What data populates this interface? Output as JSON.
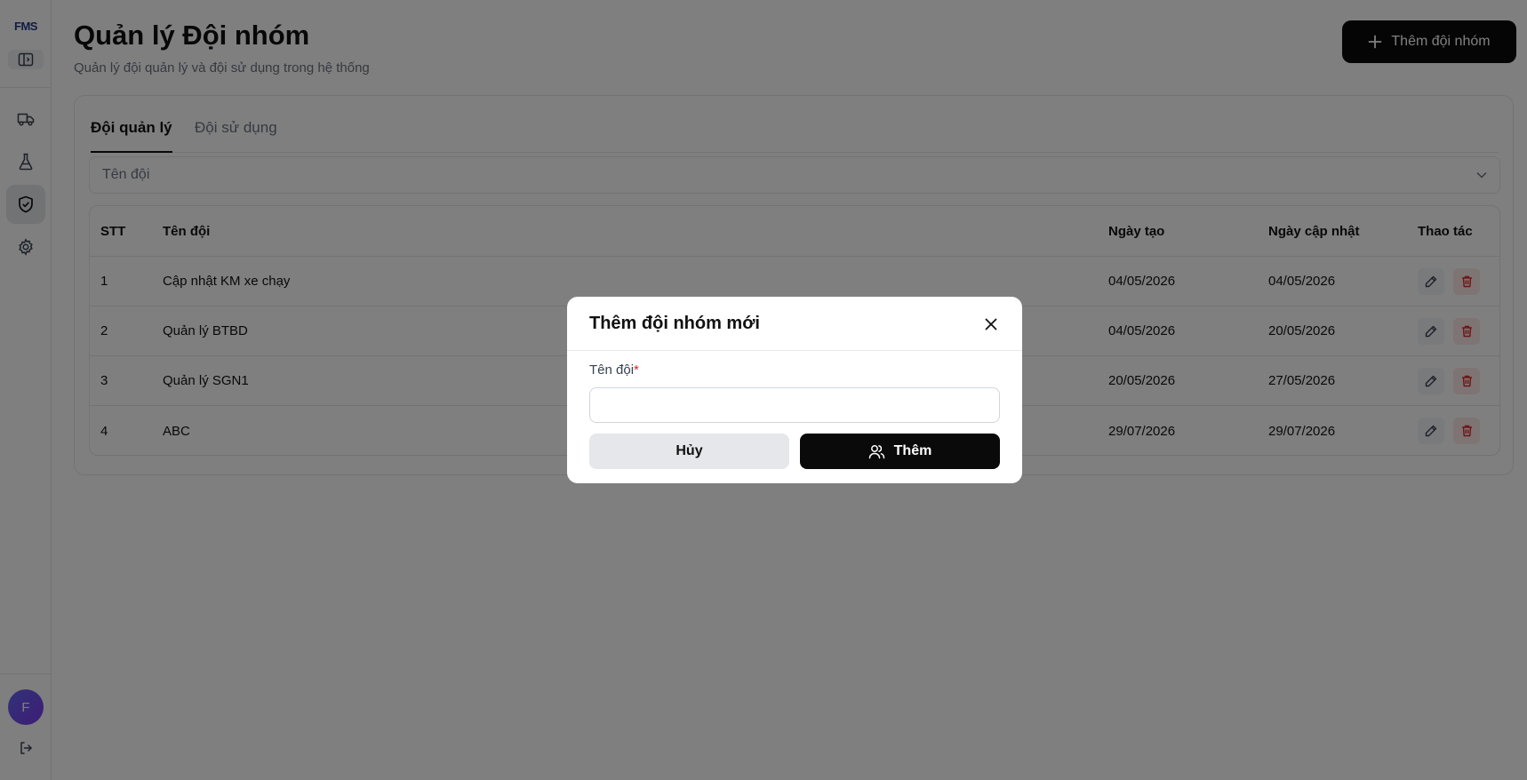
{
  "sidebar": {
    "logo": "FMS",
    "nav": [
      {
        "icon": "truck-icon"
      },
      {
        "icon": "flask-icon"
      },
      {
        "icon": "shield-check-icon",
        "active": true
      },
      {
        "icon": "gear-icon"
      }
    ],
    "avatar_initial": "F"
  },
  "header": {
    "title": "Quản lý Đội nhóm",
    "subtitle": "Quản lý đội quản lý và đội sử dụng trong hệ thống",
    "add_button": "Thêm đội nhóm"
  },
  "tabs": [
    {
      "label": "Đội quản lý",
      "active": true
    },
    {
      "label": "Đội sử dụng",
      "active": false
    }
  ],
  "filter": {
    "placeholder": "Tên đội"
  },
  "table": {
    "columns": [
      "STT",
      "Tên đội",
      "Ngày tạo",
      "Ngày cập nhật",
      "Thao tác"
    ],
    "rows": [
      {
        "stt": "1",
        "name": "Cập nhật KM xe chạy",
        "created": "04/05/2026",
        "updated": "04/05/2026"
      },
      {
        "stt": "2",
        "name": "Quản lý BTBD",
        "created": "04/05/2026",
        "updated": "20/05/2026"
      },
      {
        "stt": "3",
        "name": "Quản lý SGN1",
        "created": "20/05/2026",
        "updated": "27/05/2026"
      },
      {
        "stt": "4",
        "name": "ABC",
        "created": "29/07/2026",
        "updated": "29/07/2026"
      }
    ]
  },
  "modal": {
    "title": "Thêm đội nhóm mới",
    "field_label": "Tên đội",
    "required_mark": "*",
    "field_value": "",
    "cancel_label": "Hủy",
    "submit_label": "Thêm"
  },
  "colors": {
    "primary": "#0a0a0a",
    "danger": "#dc2626",
    "avatar": "#6d5ce8",
    "overlay": "rgba(0,0,0,0.5)"
  }
}
